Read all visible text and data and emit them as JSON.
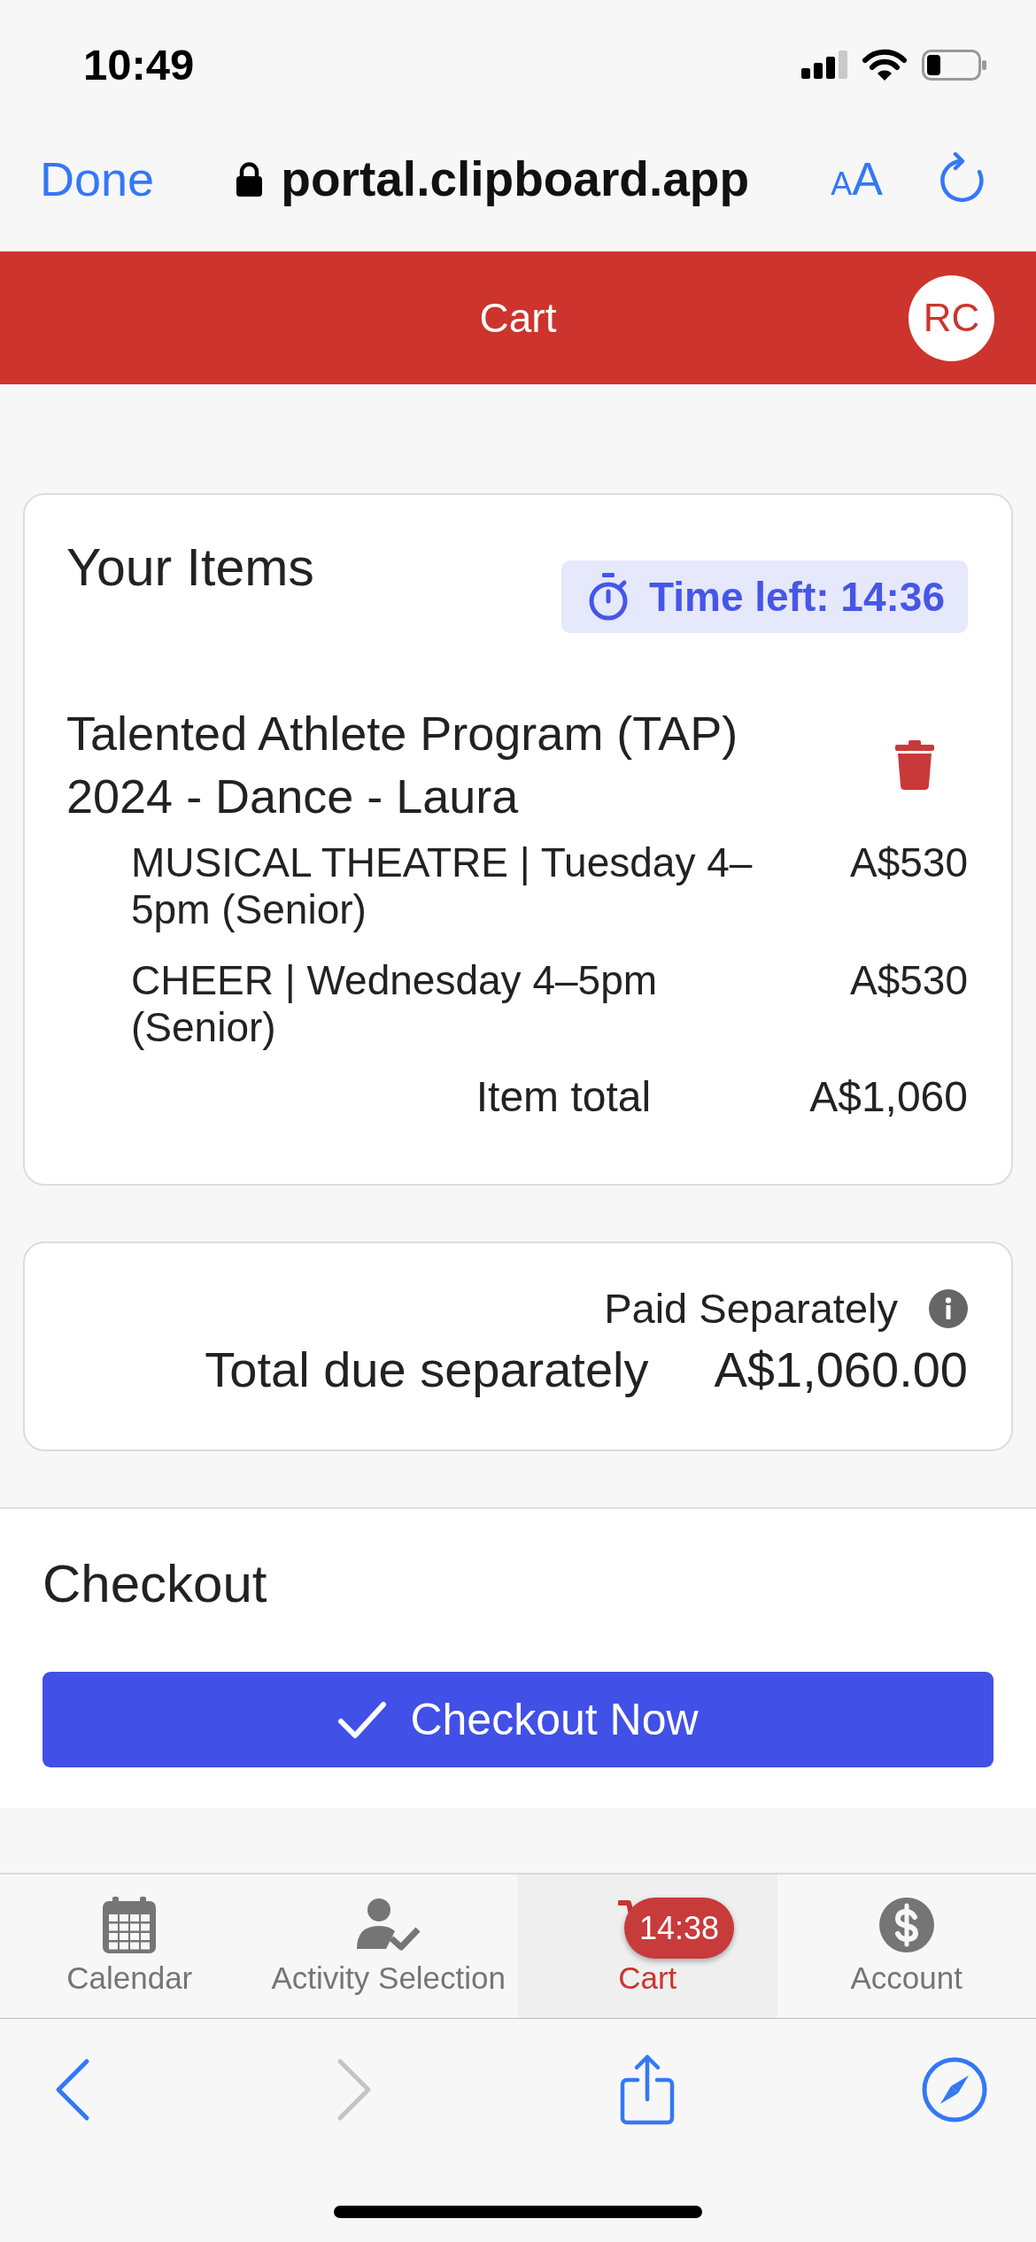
{
  "status_bar": {
    "time": "10:49"
  },
  "browser_toolbar": {
    "done": "Done",
    "url": "portal.clipboard.app",
    "text_size": "AA"
  },
  "header": {
    "title": "Cart",
    "avatar": "RC"
  },
  "items_card": {
    "title": "Your Items",
    "timer": "Time left: 14:36",
    "items": [
      {
        "name": "Talented Athlete Program (TAP) 2024 - Dance - Laura",
        "lines": [
          {
            "label": "MUSICAL THEATRE | Tuesday 4–5pm (Senior)",
            "price": "A$530"
          },
          {
            "label": "CHEER | Wednesday 4–5pm (Senior)",
            "price": "A$530"
          }
        ],
        "total_label": "Item total",
        "total": "A$1,060"
      }
    ]
  },
  "totals_card": {
    "note": "Paid Separately",
    "label": "Total due separately",
    "amount": "A$1,060.00"
  },
  "checkout": {
    "title": "Checkout",
    "button": "Checkout Now"
  },
  "tabs": [
    {
      "label": "Calendar",
      "selected": false
    },
    {
      "label": "Activity Selection",
      "selected": false
    },
    {
      "label": "Cart",
      "selected": true,
      "badge": "14:38"
    },
    {
      "label": "Account",
      "selected": false
    }
  ],
  "browser_bar": {
    "buttons": [
      {
        "kind": "back",
        "disabled": false
      },
      {
        "kind": "forward",
        "disabled": true
      },
      {
        "kind": "share",
        "disabled": false
      },
      {
        "kind": "compass",
        "disabled": false
      }
    ]
  }
}
